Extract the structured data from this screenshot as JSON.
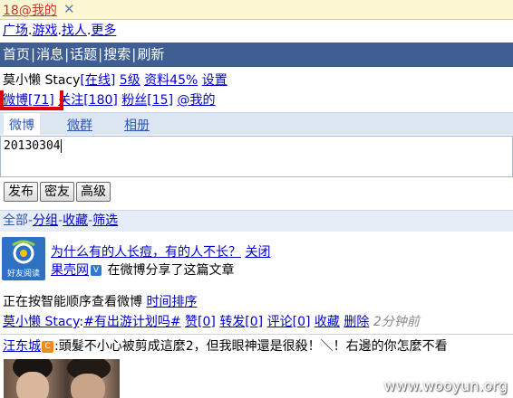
{
  "tabbar": {
    "tab_label": "18@我的",
    "close_glyph": "✕"
  },
  "topnav": {
    "items": [
      "广场",
      "游戏",
      "找人",
      "更多"
    ],
    "separator": "."
  },
  "menubar": {
    "items": [
      "首页",
      "消息",
      "话题",
      "搜索",
      "刷新"
    ],
    "separator": "|"
  },
  "user": {
    "name": "莫小懒 Stacy",
    "status": "[在线]",
    "level": "5级",
    "profile": "资料45%",
    "settings": "设置"
  },
  "stats": {
    "weibo": "微博[71]",
    "following": "关注[180]",
    "fans": "粉丝[15]",
    "mentions": "@我的"
  },
  "subtabs": {
    "items": [
      "微博",
      "微群",
      "相册"
    ],
    "active": "微博"
  },
  "compose": {
    "value": "20130304"
  },
  "buttons": {
    "publish": "发布",
    "private": "密友",
    "advanced": "高级"
  },
  "filters": {
    "all": "全部",
    "group": "分组",
    "favorites": "收藏",
    "filter": "筛选",
    "separator": "-"
  },
  "share_card": {
    "logo_caption": "好友阅读",
    "logo_icon": "swirl-logo-icon",
    "title": "为什么有的人长痘，有的人不长？",
    "close": "关闭",
    "source": "果壳网",
    "verified": "V",
    "action": "在微博分享了这篇文章"
  },
  "sort": {
    "text": "正在按智能顺序查看微博",
    "link": "时间排序"
  },
  "post1": {
    "author": "莫小懒 Stacy",
    "sep": ":",
    "topic": "#有出游计划吗#",
    "like": "赞[0]",
    "repost": "转发[0]",
    "comment": "评论[0]",
    "favorite": "收藏",
    "delete": "删除",
    "time": "2分钟前"
  },
  "post2": {
    "author": "汪东城",
    "badge": "C",
    "content": ":頭髮不小心被剪成這麼2，但我眼神還是很殺！＼！右邊的你怎麼不看"
  },
  "watermark": "www.wooyun.org",
  "colors": {
    "menubar_bg": "#3f5e93",
    "link": "#0000cc",
    "highlight_box": "#e00000",
    "tabbar_bg": "#fdf6d3"
  }
}
